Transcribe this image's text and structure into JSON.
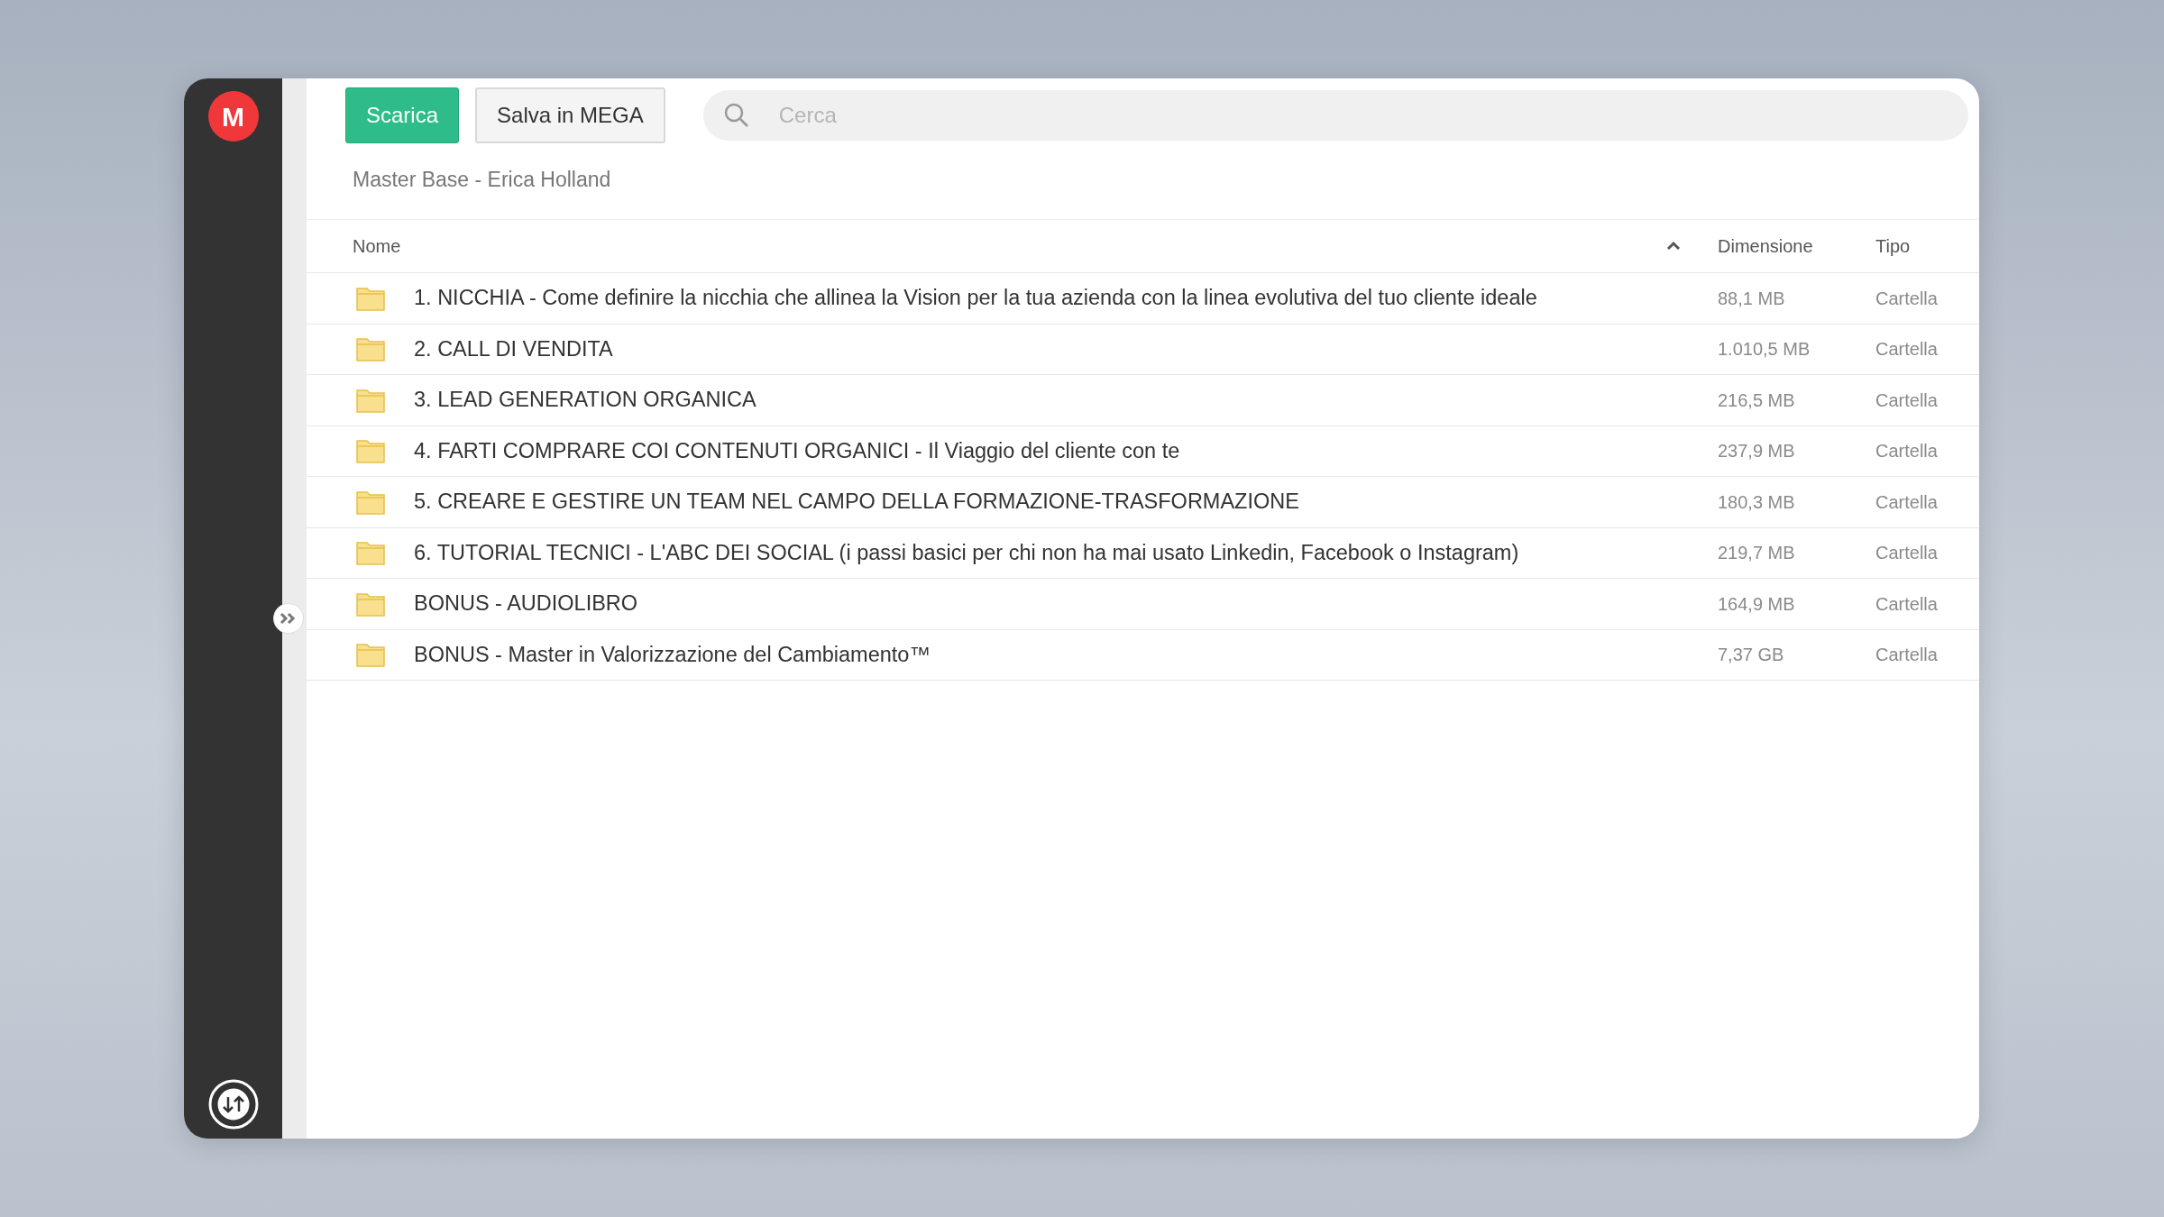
{
  "logo": {
    "letter": "M"
  },
  "toolbar": {
    "buttons": [
      {
        "label": "Scarica",
        "kind": "primary"
      },
      {
        "label": "Salva in MEGA",
        "kind": "secondary"
      }
    ],
    "search": {
      "placeholder": "Cerca"
    }
  },
  "breadcrumb": "Master Base - Erica Holland",
  "table": {
    "columns": [
      {
        "label": "Nome",
        "sort_ascending": true
      },
      {
        "label": "Dimensione"
      },
      {
        "label": "Tipo"
      }
    ],
    "rows": [
      {
        "name": "1. NICCHIA - Come definire la nicchia che allinea la Vision per la tua azienda con la linea evolutiva del tuo cliente ideale",
        "size": "88,1 MB",
        "type": "Cartella"
      },
      {
        "name": "2. CALL DI VENDITA",
        "size": "1.010,5 MB",
        "type": "Cartella"
      },
      {
        "name": "3. LEAD GENERATION ORGANICA",
        "size": "216,5 MB",
        "type": "Cartella"
      },
      {
        "name": "4. FARTI COMPRARE COI CONTENUTI ORGANICI - Il Viaggio del cliente con te",
        "size": "237,9 MB",
        "type": "Cartella"
      },
      {
        "name": "5. CREARE E GESTIRE UN TEAM NEL CAMPO DELLA FORMAZIONE-TRASFORMAZIONE",
        "size": "180,3 MB",
        "type": "Cartella"
      },
      {
        "name": "6. TUTORIAL TECNICI - L'ABC DEI SOCIAL (i passi basici per chi non ha mai usato Linkedin, Facebook o Instagram)",
        "size": "219,7 MB",
        "type": "Cartella"
      },
      {
        "name": "BONUS - AUDIOLIBRO",
        "size": "164,9 MB",
        "type": "Cartella"
      },
      {
        "name": "BONUS - Master in Valorizzazione del Cambiamento™",
        "size": "7,37 GB",
        "type": "Cartella"
      }
    ]
  }
}
